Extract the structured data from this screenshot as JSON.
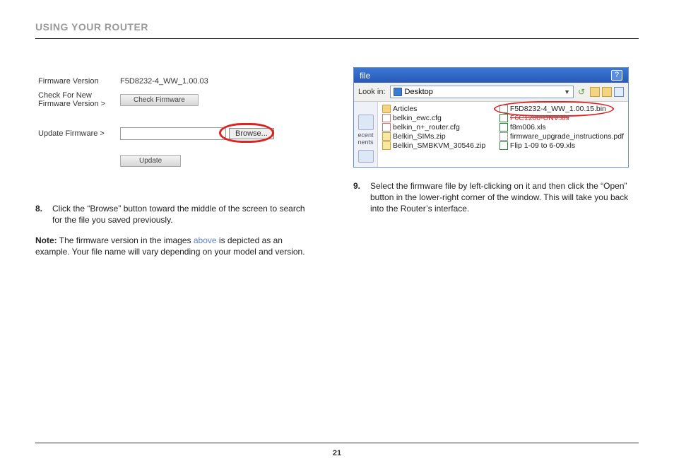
{
  "header": {
    "title": "USING YOUR ROUTER"
  },
  "firmware": {
    "version_label": "Firmware Version",
    "version_value": "F5D8232-4_WW_1.00.03",
    "check_label": "Check For New Firmware Version >",
    "check_btn": "Check Firmware",
    "update_label": "Update Firmware >",
    "browse_btn": "Browse...",
    "update_btn": "Update"
  },
  "step8": {
    "num": "8.",
    "text": "Click the “Browse” button toward the middle of the screen to search for the file you saved previously."
  },
  "note": {
    "prefix": "Note:",
    "text_a": " The firmware version in the images ",
    "link": "above",
    "text_b": " is depicted as an example. Your file name will vary depending on your model and version."
  },
  "filedialog": {
    "title": "file",
    "lookin_label": "Look in:",
    "lookin_value": "Desktop",
    "side_top": "ecent",
    "side_bot": "nents",
    "col1": [
      {
        "icon": "folder",
        "name": "Articles"
      },
      {
        "icon": "cfg",
        "name": "belkin_ewc.cfg"
      },
      {
        "icon": "cfg",
        "name": "belkin_n+_router.cfg"
      },
      {
        "icon": "zip",
        "name": "Belkin_SIMs.zip"
      },
      {
        "icon": "zip",
        "name": "Belkin_SMBKVM_30546.zip"
      }
    ],
    "col2": [
      {
        "icon": "bin",
        "name": "F5D8232-4_WW_1.00.15.bin",
        "circled": true
      },
      {
        "icon": "xls",
        "name": "F6C1200-UNV.xls",
        "strike": true
      },
      {
        "icon": "xls",
        "name": "f8m006.xls"
      },
      {
        "icon": "pdf",
        "name": "firmware_upgrade_instructions.pdf"
      },
      {
        "icon": "xls",
        "name": "Flip 1-09 to 6-09.xls"
      }
    ]
  },
  "step9": {
    "num": "9.",
    "text": "Select the firmware file by left-clicking on it and then click the “Open” button in the lower-right corner of the window. This will take you back into the Router’s interface."
  },
  "page_number": "21"
}
